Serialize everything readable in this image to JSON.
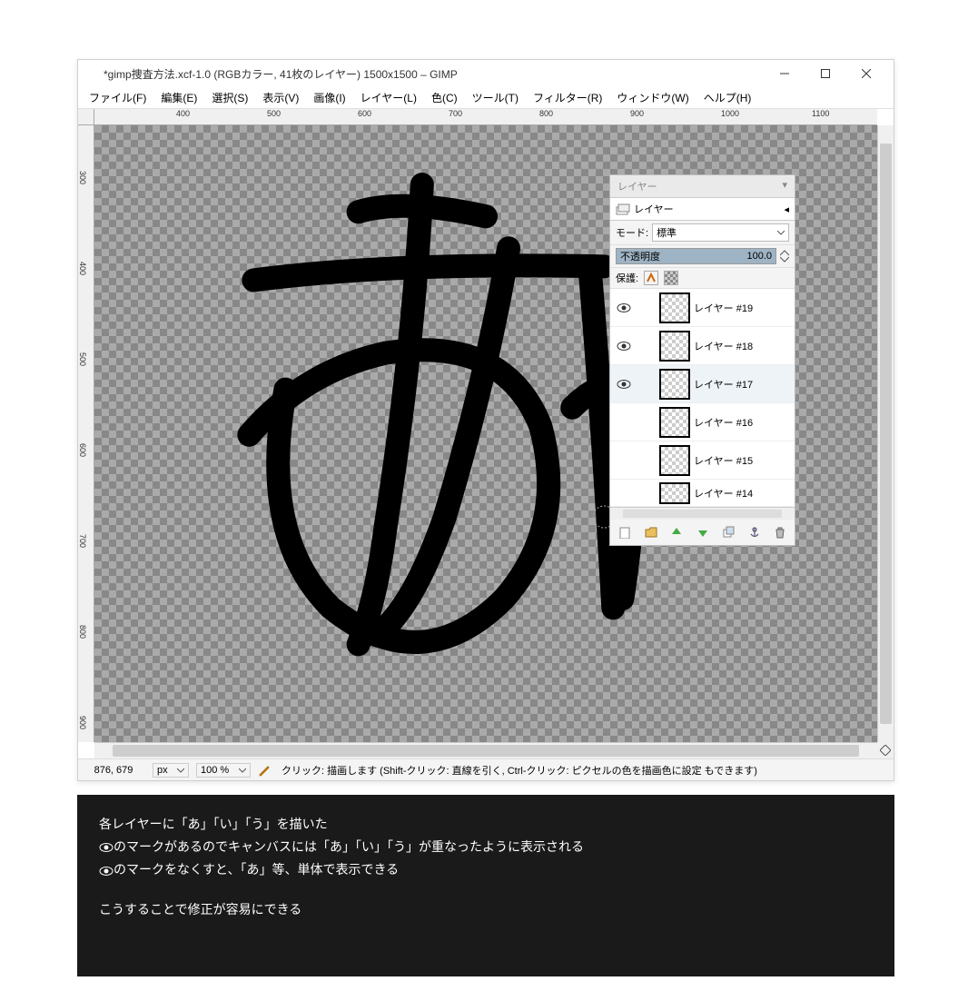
{
  "title": "*gimp捜査方法.xcf-1.0 (RGBカラー, 41枚のレイヤー) 1500x1500 – GIMP",
  "menu": [
    "ファイル(F)",
    "編集(E)",
    "選択(S)",
    "表示(V)",
    "画像(I)",
    "レイヤー(L)",
    "色(C)",
    "ツール(T)",
    "フィルター(R)",
    "ウィンドウ(W)",
    "ヘルプ(H)"
  ],
  "ruler_h": [
    "400",
    "500",
    "600",
    "700",
    "800",
    "900",
    "1000",
    "1100"
  ],
  "ruler_v": [
    "300",
    "400",
    "500",
    "600",
    "700",
    "800",
    "900"
  ],
  "status": {
    "coords": "876, 679",
    "unit": "px",
    "zoom": "100 %",
    "hint": "クリック: 描画します (Shift-クリック: 直線を引く, Ctrl-クリック: ピクセルの色を描画色に設定 もできます)"
  },
  "layers_dock": {
    "title": "レイヤー",
    "tab_label": "レイヤー",
    "mode_label": "モード:",
    "mode_value": "標準",
    "opacity_label": "不透明度",
    "opacity_value": "100.0",
    "lock_label": "保護:",
    "layers": [
      {
        "visible": true,
        "name": "レイヤー #19"
      },
      {
        "visible": true,
        "name": "レイヤー #18"
      },
      {
        "visible": true,
        "name": "レイヤー #17",
        "selected": true
      },
      {
        "visible": false,
        "name": "レイヤー #16"
      },
      {
        "visible": false,
        "name": "レイヤー #15"
      },
      {
        "visible": false,
        "name": "レイヤー #14"
      }
    ]
  },
  "caption": {
    "line1": "各レイヤーに「あ」「い」「う」を描いた",
    "line2a": "のマークがあるのでキャンバスには「あ」「い」「う」が重なったように表示される",
    "line3a": "のマークをなくすと、「あ」等、単体で表示できる",
    "line4": "こうすることで修正が容易にできる"
  }
}
